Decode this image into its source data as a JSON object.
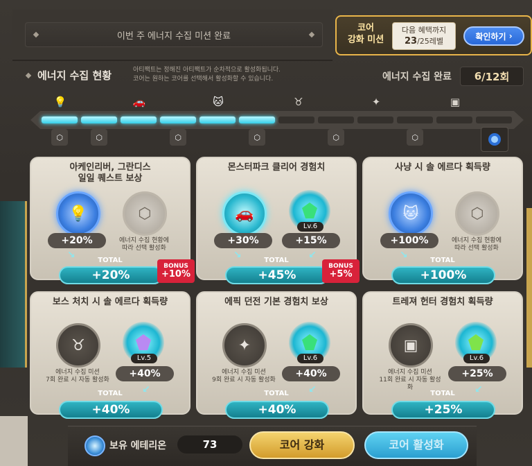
{
  "header": {
    "mission_text": "이번 주 에너지 수집 미션 완료",
    "core_title_line1": "코어",
    "core_title_line2": "강화 미션",
    "next_benefit_label": "다음 혜택까지",
    "level_current": "23",
    "level_total": "/25",
    "level_unit": "레벨",
    "confirm_label": "확인하기",
    "confirm_arrow": "›"
  },
  "status": {
    "title": "에너지 수집 현황",
    "desc_line1": "아티팩트는 정해진 아티팩트가 순차적으로 활성화됩니다.",
    "desc_line2": "코어는 원하는 코어를 선택해서 활성화할 수 있습니다.",
    "complete_label": "에너지 수집 완료",
    "count_current": "6",
    "count_total": "/12회"
  },
  "progress": {
    "completed": 6,
    "total": 12
  },
  "cards": [
    {
      "title_line1": "아케인리버, 그란디스",
      "title_line2": "일일 퀘스트 보상",
      "artifact_pct": "+20%",
      "core_note_line1": "에너지 수집 현황에",
      "core_note_line2": "따라 선택 활성화",
      "total_label": "TOTAL",
      "total": "+20%",
      "bonus_label": "BONUS",
      "bonus_value": "+10%"
    },
    {
      "title_line1": "몬스터파크 클리어 경험치",
      "artifact_pct": "+30%",
      "core_pct": "+15%",
      "core_level": "Lv.6",
      "total_label": "TOTAL",
      "total": "+45%",
      "bonus_label": "BONUS",
      "bonus_value": "+5%"
    },
    {
      "title_line1": "사냥 시 솔 에르다 획득량",
      "artifact_pct": "+100%",
      "core_note_line1": "에너지 수집 현황에",
      "core_note_line2": "따라 선택 활성화",
      "total_label": "TOTAL",
      "total": "+100%"
    },
    {
      "title_line1": "보스 처치 시 솔 에르다 획득량",
      "artifact_note_line1": "에너지 수집 미션",
      "artifact_note_line2": "7회 완료 시 자동 활성화",
      "core_pct": "+40%",
      "core_level": "Lv.5",
      "total_label": "TOTAL",
      "total": "+40%"
    },
    {
      "title_line1": "에픽 던전 기본 경험치 보상",
      "artifact_note_line1": "에너지 수집 미션",
      "artifact_note_line2": "9회 완료 시 자동 활성화",
      "core_pct": "+40%",
      "core_level": "Lv.6",
      "total_label": "TOTAL",
      "total": "+40%"
    },
    {
      "title_line1": "트레져 헌터 경험치 획득량",
      "artifact_note_line1": "에너지 수집 미션",
      "artifact_note_line2": "11회 완료 시 자동 활성화",
      "core_pct": "+25%",
      "core_level": "Lv.6",
      "total_label": "TOTAL",
      "total": "+25%"
    }
  ],
  "footer": {
    "eterion_label": "보유 에테리온",
    "eterion_value": "73",
    "core_upgrade_label": "코어 강화",
    "core_activate_label": "코어 활성화"
  },
  "icons": {
    "bulb": "lightbulb-icon",
    "car": "car-icon",
    "cat": "cat-mask-icon",
    "bull": "bull-icon",
    "star": "compass-star-icon",
    "chest": "chest-icon",
    "core": "core-crystal-icon"
  },
  "colors": {
    "accent_cyan": "#35cfe8",
    "bonus_red": "#d8223a",
    "gold": "#e9b54a",
    "confirm_blue": "#2868d8"
  }
}
